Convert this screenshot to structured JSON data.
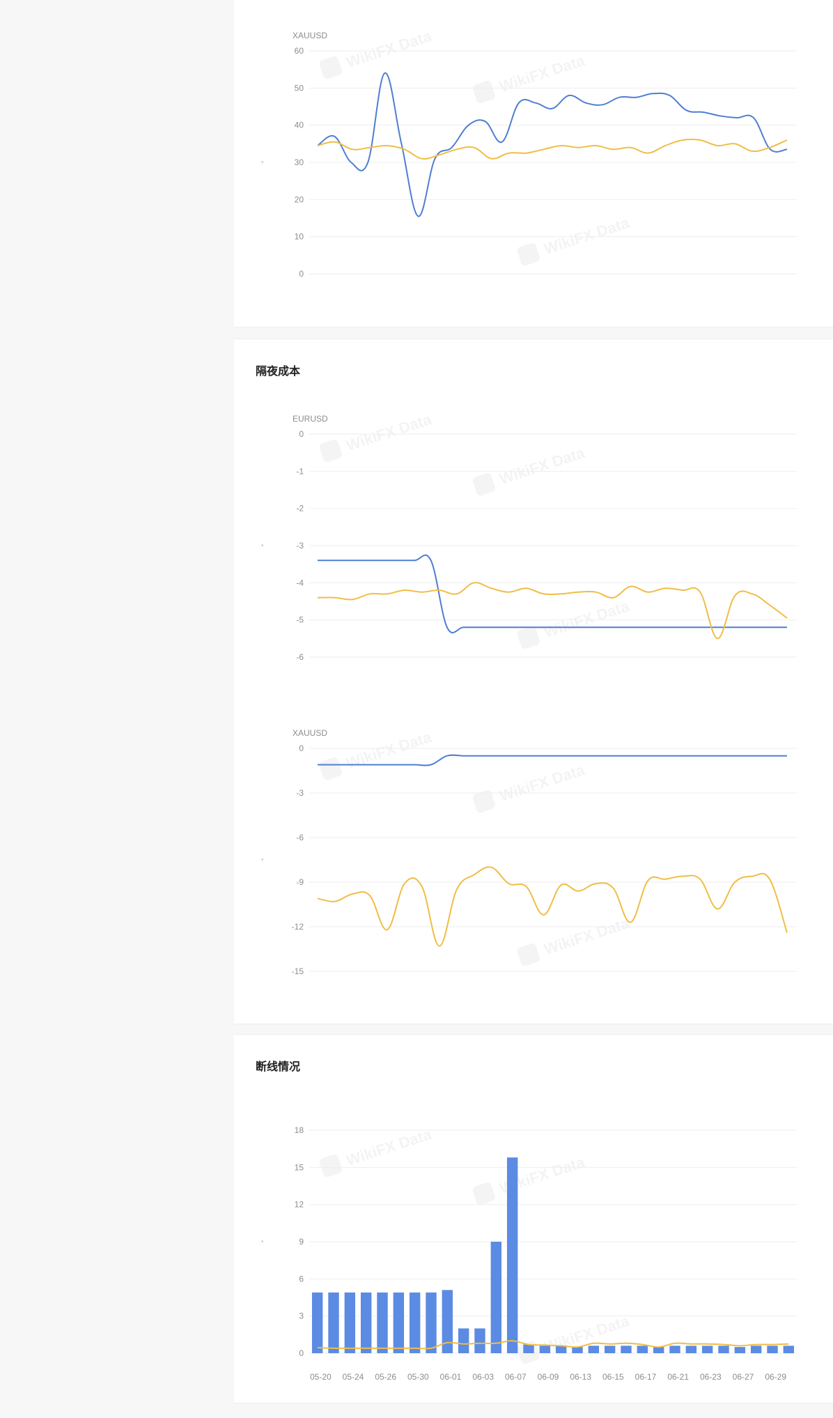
{
  "sections": {
    "overnight_title": "隔夜成本",
    "disconnect_title": "断线情况"
  },
  "colors": {
    "series_blue": "#4e7ed1",
    "series_yellow": "#f0bd45",
    "bar_blue": "#5b8be3"
  },
  "watermark_text": "WikiFX Data",
  "chart_data": [
    {
      "id": "spread_xauusd",
      "type": "line",
      "symbol": "XAUUSD",
      "ylim": [
        0,
        60
      ],
      "yticks": [
        0,
        10,
        20,
        30,
        40,
        50,
        60
      ],
      "series": [
        {
          "color": "#4e7ed1",
          "values": [
            34.5,
            37,
            30,
            30,
            54,
            35,
            15.5,
            31,
            34,
            40,
            41,
            35.5,
            46,
            46,
            44.5,
            48,
            46,
            45.5,
            47.5,
            47.5,
            48.5,
            48,
            44,
            43.5,
            42.5,
            42,
            42,
            33.5,
            33.5
          ]
        },
        {
          "color": "#f0bd45",
          "values": [
            34.5,
            35.5,
            33.5,
            34,
            34.5,
            33.5,
            31,
            32,
            33.5,
            34,
            31,
            32.5,
            32.5,
            33.5,
            34.5,
            34,
            34.5,
            33.5,
            34,
            32.5,
            34.5,
            36,
            36,
            34.5,
            35,
            33,
            34,
            36
          ]
        }
      ]
    },
    {
      "id": "overnight_eurusd",
      "type": "line",
      "symbol": "EURUSD",
      "ylim": [
        -6,
        0
      ],
      "yticks": [
        0,
        -1,
        -2,
        -3,
        -4,
        -5,
        -6
      ],
      "series": [
        {
          "color": "#4e7ed1",
          "values": [
            -3.4,
            -3.4,
            -3.4,
            -3.4,
            -3.4,
            -3.4,
            -3.4,
            -3.4,
            -5.2,
            -5.2,
            -5.2,
            -5.2,
            -5.2,
            -5.2,
            -5.2,
            -5.2,
            -5.2,
            -5.2,
            -5.2,
            -5.2,
            -5.2,
            -5.2,
            -5.2,
            -5.2,
            -5.2,
            -5.2,
            -5.2,
            -5.2,
            -5.2,
            -5.2
          ]
        },
        {
          "color": "#f0bd45",
          "values": [
            -4.4,
            -4.4,
            -4.45,
            -4.3,
            -4.3,
            -4.2,
            -4.25,
            -4.2,
            -4.3,
            -4.0,
            -4.15,
            -4.25,
            -4.15,
            -4.3,
            -4.3,
            -4.25,
            -4.25,
            -4.4,
            -4.1,
            -4.25,
            -4.15,
            -4.2,
            -4.25,
            -5.5,
            -4.35,
            -4.3,
            -4.6,
            -4.95
          ]
        }
      ]
    },
    {
      "id": "overnight_xauusd",
      "type": "line",
      "symbol": "XAUUSD",
      "ylim": [
        -15,
        0
      ],
      "yticks": [
        0,
        -3,
        -6,
        -9,
        -12,
        -15
      ],
      "series": [
        {
          "color": "#4e7ed1",
          "values": [
            -1.1,
            -1.1,
            -1.1,
            -1.1,
            -1.1,
            -1.1,
            -1.1,
            -1.1,
            -0.5,
            -0.5,
            -0.5,
            -0.5,
            -0.5,
            -0.5,
            -0.5,
            -0.5,
            -0.5,
            -0.5,
            -0.5,
            -0.5,
            -0.5,
            -0.5,
            -0.5,
            -0.5,
            -0.5,
            -0.5,
            -0.5,
            -0.5,
            -0.5,
            -0.5
          ]
        },
        {
          "color": "#f0bd45",
          "values": [
            -10.1,
            -10.3,
            -9.8,
            -9.9,
            -12.2,
            -9.1,
            -9.3,
            -13.3,
            -9.5,
            -8.5,
            -8.0,
            -9.1,
            -9.3,
            -11.2,
            -9.2,
            -9.6,
            -9.1,
            -9.4,
            -11.7,
            -8.9,
            -8.8,
            -8.6,
            -8.8,
            -10.8,
            -9.0,
            -8.6,
            -8.8,
            -12.4
          ]
        }
      ]
    },
    {
      "id": "disconnect",
      "type": "bar",
      "ylim": [
        0,
        18
      ],
      "yticks": [
        0,
        3,
        6,
        9,
        12,
        15,
        18
      ],
      "xticks": [
        "05-20",
        "05-24",
        "05-26",
        "05-30",
        "06-01",
        "06-03",
        "06-07",
        "06-09",
        "06-13",
        "06-15",
        "06-17",
        "06-21",
        "06-23",
        "06-27",
        "06-29"
      ],
      "series": [
        {
          "color": "#5b8be3",
          "values": [
            4.9,
            4.9,
            4.9,
            4.9,
            4.9,
            4.9,
            4.9,
            4.9,
            5.1,
            2.0,
            2.0,
            9.0,
            15.8,
            0.7,
            0.6,
            0.6,
            0.5,
            0.6,
            0.6,
            0.6,
            0.6,
            0.5,
            0.6,
            0.6,
            0.6,
            0.6,
            0.5,
            0.6,
            0.6,
            0.6
          ]
        },
        {
          "color": "#f0bd45",
          "values": [
            0.45,
            0.4,
            0.4,
            0.4,
            0.4,
            0.4,
            0.4,
            0.4,
            0.85,
            0.75,
            0.8,
            0.8,
            1.0,
            0.7,
            0.65,
            0.6,
            0.5,
            0.8,
            0.75,
            0.8,
            0.7,
            0.5,
            0.8,
            0.75,
            0.75,
            0.7,
            0.6,
            0.7,
            0.7,
            0.75
          ]
        }
      ]
    }
  ]
}
